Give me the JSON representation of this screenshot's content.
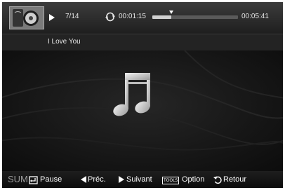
{
  "player": {
    "track_count": "7/14",
    "elapsed_time": "00:01:15",
    "total_time": "00:05:41",
    "progress": 0.22,
    "song_title": "I Love You"
  },
  "controls": {
    "sum_label": "SUM",
    "pause_label": "Pause",
    "prev_label": "Préc.",
    "next_label": "Suivant",
    "tools_badge": "TOOLS",
    "option_label": "Option",
    "return_label": "Retour"
  },
  "icons": {
    "thumbnail": "album-art-thumbnail",
    "play": "play-icon",
    "repeat": "repeat-icon",
    "note": "music-note-icon"
  },
  "colors": {
    "background": "#141414",
    "text": "#e6e6e6",
    "progress_fill": "#d0d0d0"
  }
}
